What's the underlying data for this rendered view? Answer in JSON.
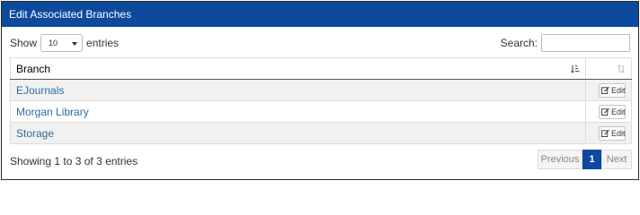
{
  "panel": {
    "title": "Edit Associated Branches"
  },
  "length_menu": {
    "show_label": "Show",
    "selected": "10",
    "entries_label": "entries"
  },
  "search": {
    "label": "Search:",
    "value": "",
    "placeholder": ""
  },
  "table": {
    "columns": [
      {
        "label": "Branch"
      },
      {
        "label": ""
      }
    ],
    "rows": [
      {
        "branch": "EJournals",
        "action": "Edit"
      },
      {
        "branch": "Morgan Library",
        "action": "Edit"
      },
      {
        "branch": "Storage",
        "action": "Edit"
      }
    ]
  },
  "info": "Showing 1 to 3 of 3 entries",
  "pagination": {
    "previous": "Previous",
    "current": "1",
    "next": "Next"
  },
  "colors": {
    "header_bg": "#0d4a9e",
    "link": "#2e6da4",
    "stripe": "#f1f1f1"
  }
}
